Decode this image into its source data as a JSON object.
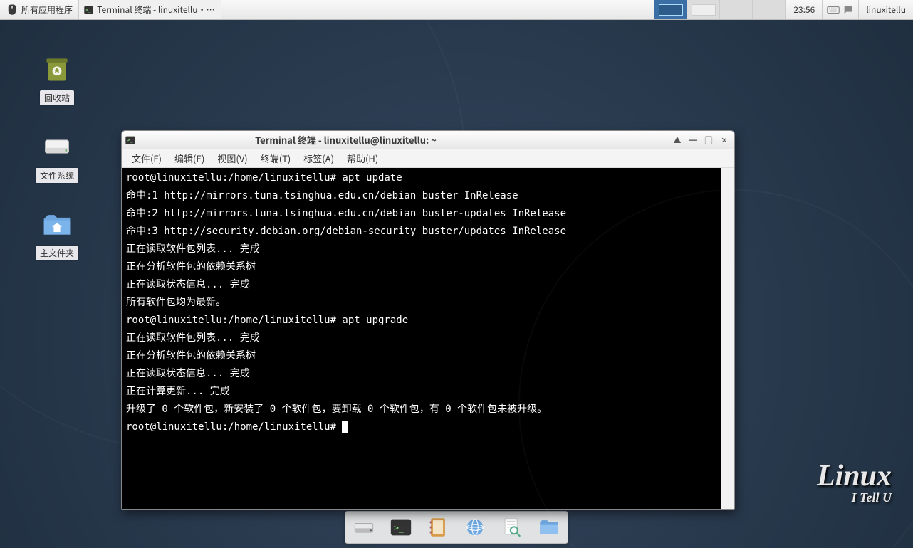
{
  "panel": {
    "applications_menu": "所有应用程序",
    "taskbar_item": "Terminal 终端 - linuxitellu···",
    "clock": "23:56",
    "user": "linuxitellu"
  },
  "desktop_icons": {
    "trash": "回收站",
    "filesystem": "文件系统",
    "home": "主文件夹"
  },
  "watermark": {
    "line1": "Linux",
    "line2": "I Tell U"
  },
  "terminal_window": {
    "title": "Terminal 终端 - linuxitellu@linuxitellu: ~",
    "menus": {
      "file": "文件(F)",
      "edit": "编辑(E)",
      "view": "视图(V)",
      "terminal": "终端(T)",
      "tabs": "标签(A)",
      "help": "帮助(H)"
    },
    "lines": [
      "root@linuxitellu:/home/linuxitellu# apt update",
      "命中:1 http://mirrors.tuna.tsinghua.edu.cn/debian buster InRelease",
      "命中:2 http://mirrors.tuna.tsinghua.edu.cn/debian buster-updates InRelease",
      "命中:3 http://security.debian.org/debian-security buster/updates InRelease",
      "正在读取软件包列表... 完成",
      "正在分析软件包的依赖关系树",
      "正在读取状态信息... 完成",
      "所有软件包均为最新。",
      "root@linuxitellu:/home/linuxitellu# apt upgrade",
      "正在读取软件包列表... 完成",
      "正在分析软件包的依赖关系树",
      "正在读取状态信息... 完成",
      "正在计算更新... 完成",
      "升级了 0 个软件包，新安装了 0 个软件包，要卸载 0 个软件包，有 0 个软件包未被升级。",
      "root@linuxitellu:/home/linuxitellu# "
    ]
  },
  "dock": {
    "items": [
      "drive",
      "terminal",
      "addressbook",
      "browser",
      "search",
      "files"
    ]
  }
}
